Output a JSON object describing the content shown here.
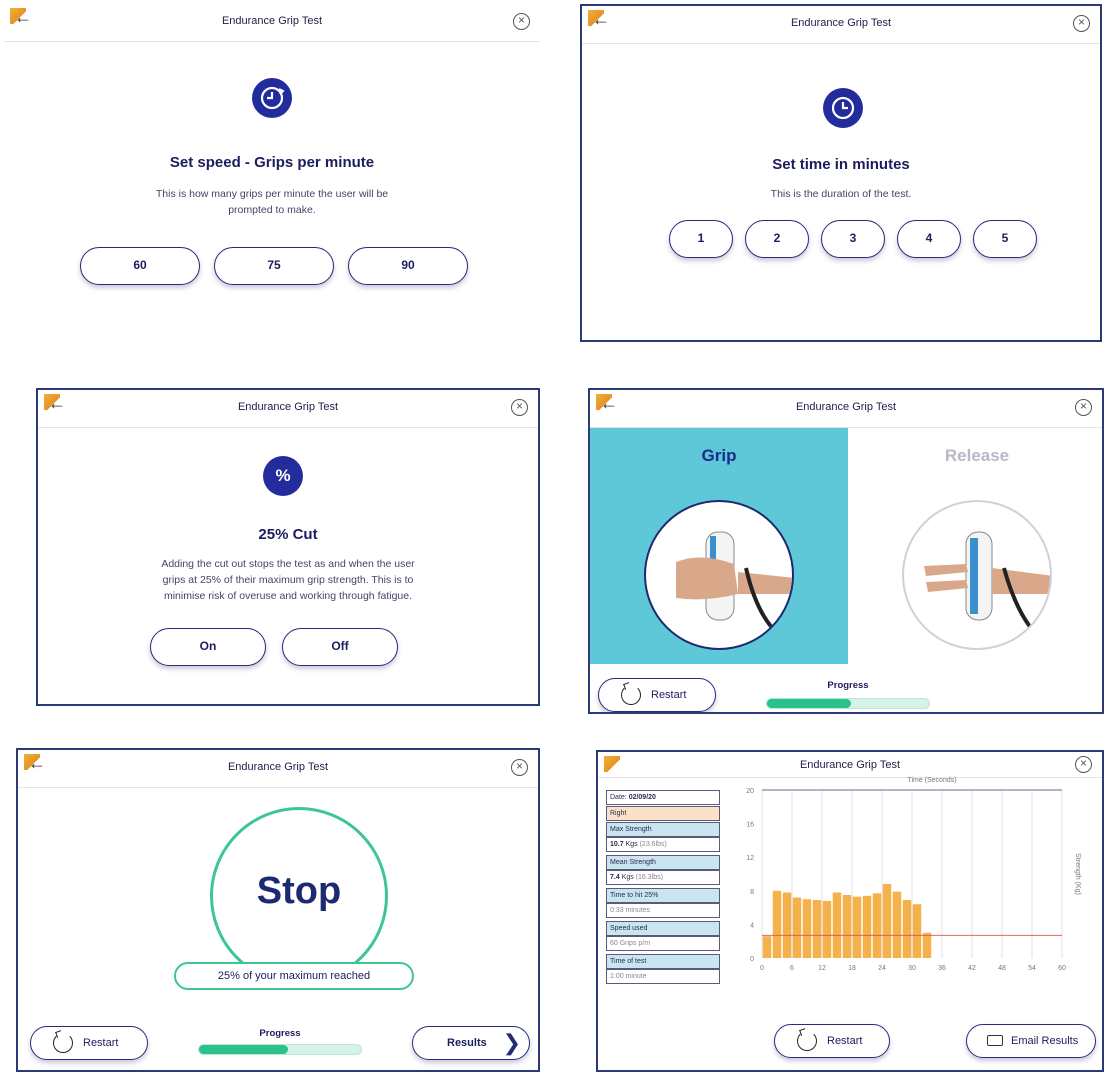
{
  "app_title": "Endurance Grip Test",
  "speed_screen": {
    "title": "Set speed - Grips per minute",
    "description_line1": "This is how many grips per minute the user will be",
    "description_line2": "prompted to make.",
    "options": [
      "60",
      "75",
      "90"
    ]
  },
  "time_screen": {
    "title": "Set time in minutes",
    "description": "This is the duration of the test.",
    "options": [
      "1",
      "2",
      "3",
      "4",
      "5"
    ]
  },
  "cut_screen": {
    "icon_symbol": "%",
    "title": "25% Cut",
    "description_line1": "Adding the cut out stops the test as and when the user",
    "description_line2": "grips at 25% of their maximum grip strength. This is to",
    "description_line3": "minimise risk of overuse and working through fatigue.",
    "options": [
      "On",
      "Off"
    ]
  },
  "grip_screen": {
    "grip_label": "Grip",
    "release_label": "Release",
    "restart_label": "Restart",
    "progress_label": "Progress",
    "progress_fraction": 0.52
  },
  "stop_screen": {
    "stop_label": "Stop",
    "message": "25% of your maximum reached",
    "restart_label": "Restart",
    "progress_label": "Progress",
    "progress_fraction": 0.55,
    "results_label": "Results"
  },
  "results_screen": {
    "stats": {
      "date_label": "Date:",
      "date_value": "02/09/20",
      "side": "Right",
      "max_strength_label": "Max Strength",
      "max_strength_kg": "10.7",
      "max_strength_unit": "Kgs",
      "max_strength_lbs": "(23.6lbs)",
      "mean_strength_label": "Mean Strength",
      "mean_strength_kg": "7.4",
      "mean_strength_unit": "Kgs",
      "mean_strength_lbs": "(16.3lbs)",
      "time_to_25_label": "Time to hit 25%",
      "time_to_25_value": "0:33 minutes",
      "speed_label": "Speed used",
      "speed_value": "60 Grips p/m",
      "time_of_test_label": "Time of test",
      "time_of_test_value": "1:00 minute"
    },
    "restart_label": "Restart",
    "email_label": "Email Results"
  },
  "colors": {
    "primary": "#232c9c",
    "grip_bg": "#5fc8d8",
    "accent_green": "#3bc694",
    "bar_orange": "#f6b24a",
    "stat_header": "#c9e6f0",
    "stat_side": "#fbe1c8",
    "threshold_line": "#d9534f"
  },
  "chart_data": {
    "type": "bar",
    "xlabel": "Time (Seconds)",
    "ylabel": "Strength (Kg)",
    "xlim": [
      0,
      60
    ],
    "ylim": [
      0,
      20
    ],
    "x_ticks": [
      0,
      6,
      12,
      18,
      24,
      30,
      36,
      42,
      48,
      54,
      60
    ],
    "y_ticks": [
      0,
      4,
      8,
      12,
      16,
      20
    ],
    "x": [
      1,
      3,
      5,
      7,
      9,
      11,
      13,
      15,
      17,
      19,
      21,
      23,
      25,
      27,
      29,
      31,
      33
    ],
    "values": [
      2.6,
      8.0,
      7.8,
      7.2,
      7.0,
      6.9,
      6.8,
      7.8,
      7.5,
      7.3,
      7.4,
      7.7,
      8.8,
      7.9,
      6.9,
      6.4,
      3.0
    ],
    "threshold": 2.7,
    "grid": true
  }
}
